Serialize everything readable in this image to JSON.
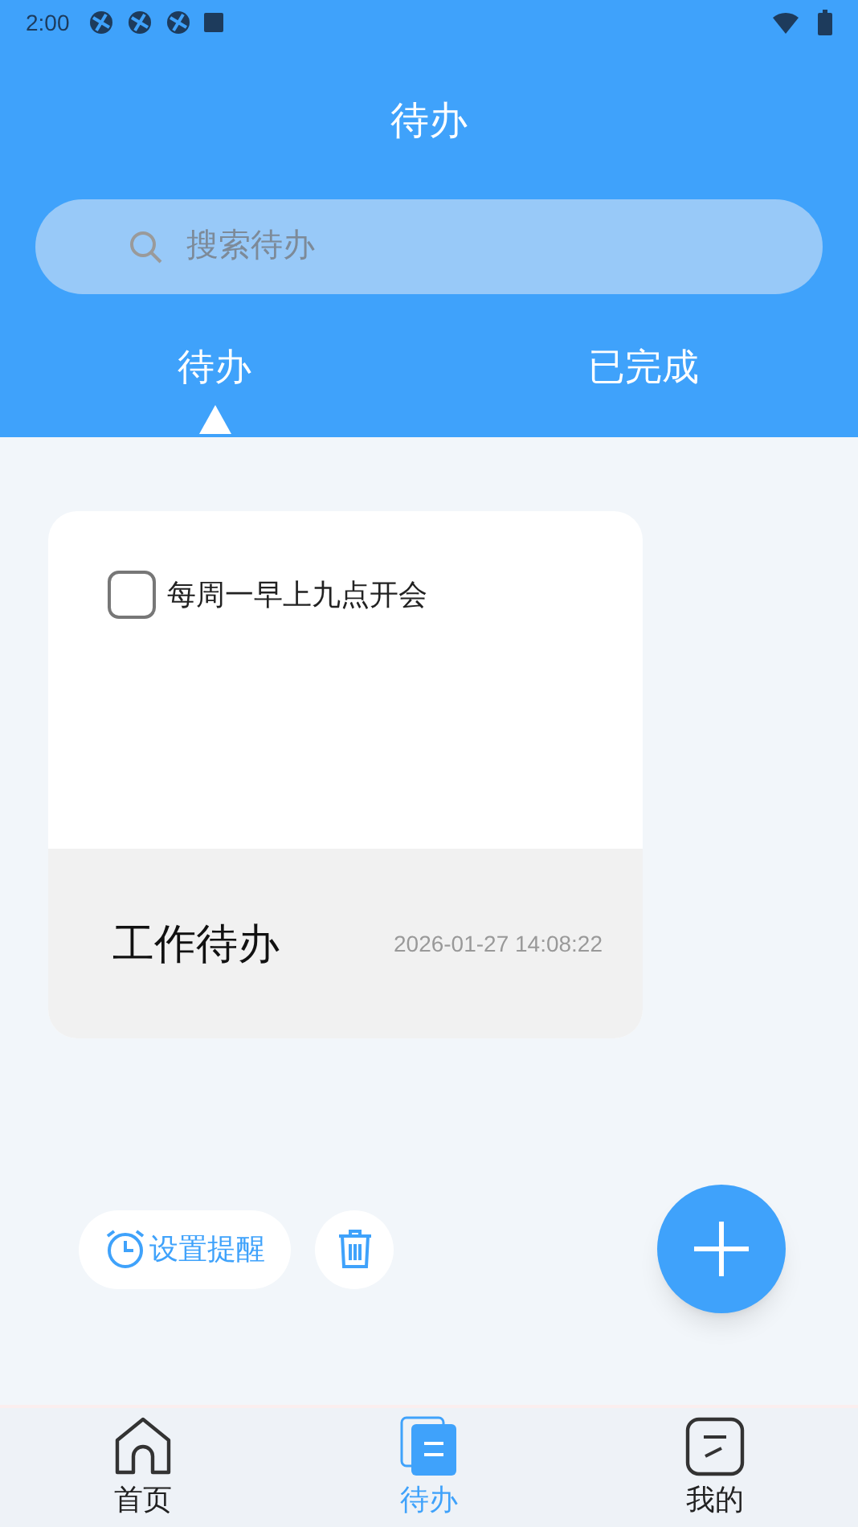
{
  "status_bar": {
    "time": "2:00"
  },
  "header": {
    "title": "待办"
  },
  "search": {
    "placeholder": "搜索待办"
  },
  "tabs": [
    {
      "label": "待办",
      "selected": true
    },
    {
      "label": "已完成",
      "selected": false
    }
  ],
  "card": {
    "items": [
      {
        "text": "每周一早上九点开会",
        "checked": false
      }
    ],
    "category": "工作待办",
    "timestamp": "2026-01-27 14:08:22"
  },
  "actions": {
    "reminder": "设置提醒"
  },
  "bottom_nav": [
    {
      "label": "首页",
      "selected": false,
      "kind": "home"
    },
    {
      "label": "待办",
      "selected": true,
      "kind": "todo"
    },
    {
      "label": "我的",
      "selected": false,
      "kind": "profile"
    }
  ]
}
